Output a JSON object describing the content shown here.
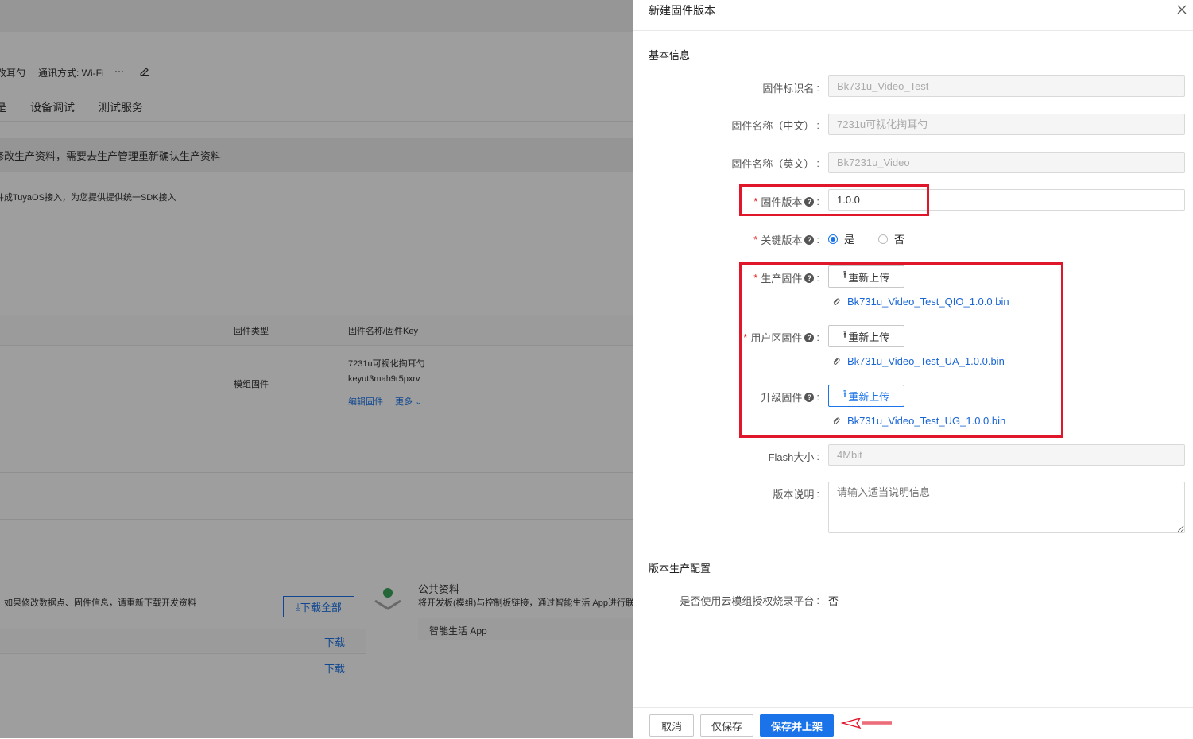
{
  "background": {
    "header_fragment": "改耳勺",
    "comm_mode": "通讯方式: Wi-Fi",
    "more_dots": "···",
    "tabs": [
      "是",
      "设备调试",
      "测试服务"
    ],
    "notice": "修改生产资料，需要去生产管理重新确认生产资料",
    "integration_text": "并成TuyaOS接入，为您提供提供统一SDK接入",
    "table": {
      "col_type": "固件类型",
      "col_name_key": "固件名称/固件Key",
      "row_type": "模组固件",
      "row_name": "7231u可视化掏耳勺",
      "row_key": "keyut3mah9r5pxrv",
      "action_edit": "编辑固件",
      "action_more": "更多"
    },
    "download_hint": "如果修改数据点、固件信息，请重新下载开发资料",
    "download_all": "下载全部",
    "public_title": "公共资料",
    "public_desc": "将开发板(模组)与控制板链接，通过智能生活 App进行联",
    "app_label": "智能生活 App",
    "download_1": "下载",
    "download_2": "下载"
  },
  "drawer": {
    "title": "新建固件版本",
    "section_basic": "基本信息",
    "fields": {
      "firmware_id_label": "固件标识名",
      "firmware_id_value": "Bk731u_Video_Test",
      "name_cn_label": "固件名称（中文）",
      "name_cn_value": "7231u可视化掏耳勺",
      "name_en_label": "固件名称（英文）",
      "name_en_value": "Bk7231u_Video",
      "version_label": "固件版本",
      "version_value": "1.0.0",
      "key_version_label": "关键版本",
      "key_yes": "是",
      "key_no": "否",
      "prod_fw_label": "生产固件",
      "prod_fw_btn": "重新上传",
      "prod_fw_file": "Bk731u_Video_Test_QIO_1.0.0.bin",
      "user_fw_label": "用户区固件",
      "user_fw_btn": "重新上传",
      "user_fw_file": "Bk731u_Video_Test_UA_1.0.0.bin",
      "upgrade_fw_label": "升级固件",
      "upgrade_fw_btn": "重新上传",
      "upgrade_fw_file": "Bk731u_Video_Test_UG_1.0.0.bin",
      "flash_label": "Flash大小",
      "flash_value": "4Mbit",
      "desc_label": "版本说明",
      "desc_placeholder": "请输入适当说明信息"
    },
    "section_prod": "版本生产配置",
    "cloud_label": "是否使用云模组授权烧录平台",
    "cloud_value": "否",
    "footer": {
      "cancel": "取消",
      "save_only": "仅保存",
      "save_publish": "保存并上架"
    },
    "colors": {
      "primary": "#1a73e8",
      "annotation": "#e0162b"
    }
  }
}
